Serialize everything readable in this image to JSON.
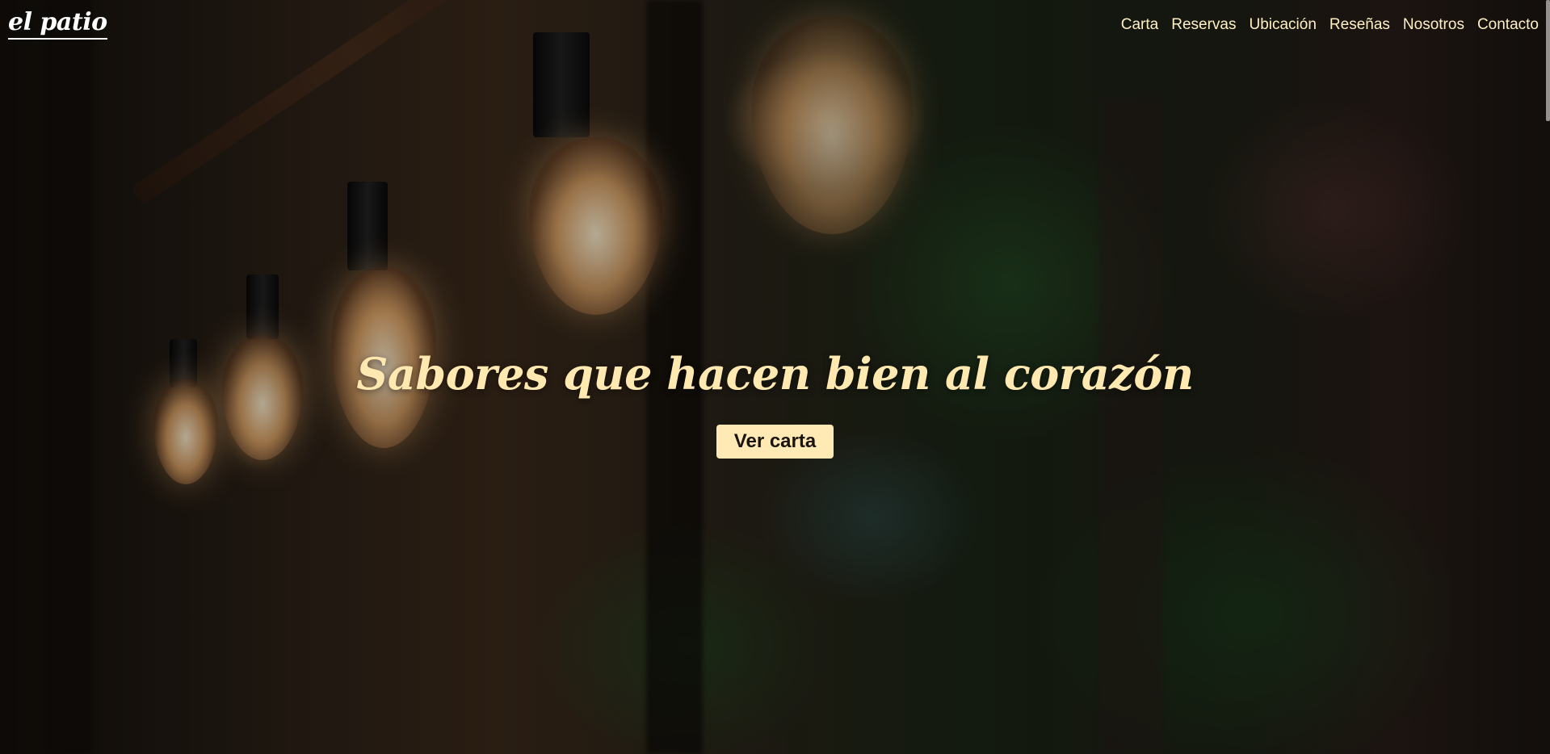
{
  "brand": {
    "logo_text": "el patio"
  },
  "nav": {
    "items": [
      {
        "label": "Carta"
      },
      {
        "label": "Reservas"
      },
      {
        "label": "Ubicación"
      },
      {
        "label": "Reseñas"
      },
      {
        "label": "Nosotros"
      },
      {
        "label": "Contacto"
      }
    ]
  },
  "hero": {
    "title": "Sabores que hacen bien al corazón",
    "cta_label": "Ver carta"
  },
  "colors": {
    "accent": "#ffe9b0",
    "button_bg": "#ffeab6",
    "nav_text": "#ffefc4"
  }
}
